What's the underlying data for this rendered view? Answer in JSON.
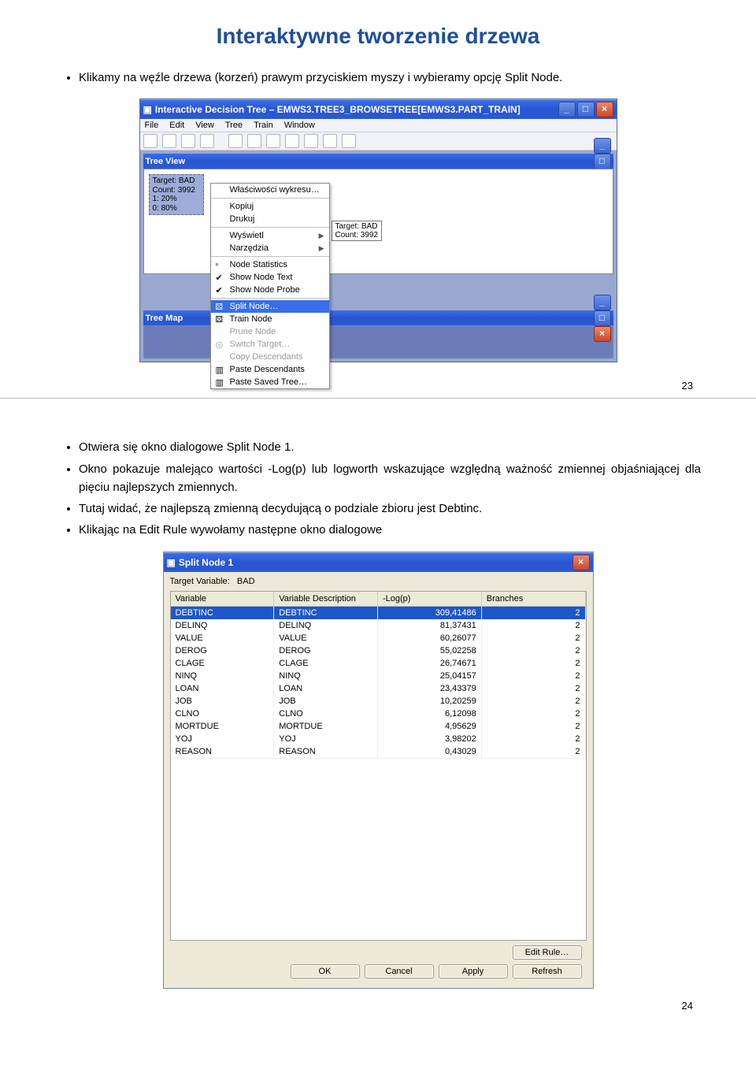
{
  "slide1": {
    "title": "Interaktywne tworzenie drzewa",
    "bullet": "Klikamy na węźle drzewa (korzeń) prawym przyciskiem myszy i wybieramy opcję Split Node.",
    "page_number": "23"
  },
  "app_window": {
    "title": "Interactive Decision Tree – EMWS3.TREE3_BROWSETREE[EMWS3.PART_TRAIN]",
    "menu": [
      "File",
      "Edit",
      "View",
      "Tree",
      "Train",
      "Window"
    ],
    "subtitle_treeview": "Tree View",
    "subtitle_treemap": "Tree Map",
    "root_node": {
      "target": "Target:  BAD",
      "count": "Count:  3992",
      "p1": "1:  20%",
      "p0": "0:  80%",
      "label_bad": "BAD",
      "label_cnt": "3992"
    },
    "context_menu": {
      "props": "Właściwości wykresu…",
      "copy": "Kopiuj",
      "print": "Drukuj",
      "view": "Wyświetl",
      "tools": "Narzędzia",
      "node_stats": "Node Statistics",
      "show_node_text": "Show Node Text",
      "show_node_probe": "Show Node Probe",
      "split_node": "Split Node…",
      "train_node": "Train Node",
      "prune_node": "Prune Node",
      "switch_target": "Switch Target…",
      "copy_desc": "Copy Descendants",
      "paste_desc": "Paste Descendants",
      "paste_saved": "Paste Saved Tree…"
    },
    "tooltip": {
      "t1": "Target:  BAD",
      "t2": "Count:  3992"
    }
  },
  "slide2": {
    "b1": "Otwiera się okno dialogowe Split Node 1.",
    "b2": "Okno pokazuje malejąco wartości -Log(p) lub logworth wskazujące względną ważność zmiennej objaśniającej dla pięciu najlepszych zmiennych.",
    "b3": "Tutaj widać, że najlepszą zmienną decydującą o podziale zbioru jest Debtinc.",
    "b4": "Klikając na Edit Rule wywołamy następne okno dialogowe",
    "page_number": "24"
  },
  "dialog": {
    "title": "Split Node 1",
    "target_variable_label": "Target Variable:",
    "target_variable_value": "BAD",
    "headers": {
      "c1": "Variable",
      "c2": "Variable Description",
      "c3": "-Log(p)",
      "c4": "Branches"
    },
    "rows": [
      {
        "v": "DEBTINC",
        "d": "DEBTINC",
        "lp": "309,41486",
        "b": "2"
      },
      {
        "v": "DELINQ",
        "d": "DELINQ",
        "lp": "81,37431",
        "b": "2"
      },
      {
        "v": "VALUE",
        "d": "VALUE",
        "lp": "60,26077",
        "b": "2"
      },
      {
        "v": "DEROG",
        "d": "DEROG",
        "lp": "55,02258",
        "b": "2"
      },
      {
        "v": "CLAGE",
        "d": "CLAGE",
        "lp": "26,74671",
        "b": "2"
      },
      {
        "v": "NINQ",
        "d": "NINQ",
        "lp": "25,04157",
        "b": "2"
      },
      {
        "v": "LOAN",
        "d": "LOAN",
        "lp": "23,43379",
        "b": "2"
      },
      {
        "v": "JOB",
        "d": "JOB",
        "lp": "10,20259",
        "b": "2"
      },
      {
        "v": "CLNO",
        "d": "CLNO",
        "lp": "6,12098",
        "b": "2"
      },
      {
        "v": "MORTDUE",
        "d": "MORTDUE",
        "lp": "4,95629",
        "b": "2"
      },
      {
        "v": "YOJ",
        "d": "YOJ",
        "lp": "3,98202",
        "b": "2"
      },
      {
        "v": "REASON",
        "d": "REASON",
        "lp": "0,43029",
        "b": "2"
      }
    ],
    "buttons": {
      "edit_rule": "Edit Rule…",
      "ok": "OK",
      "cancel": "Cancel",
      "apply": "Apply",
      "refresh": "Refresh"
    }
  }
}
